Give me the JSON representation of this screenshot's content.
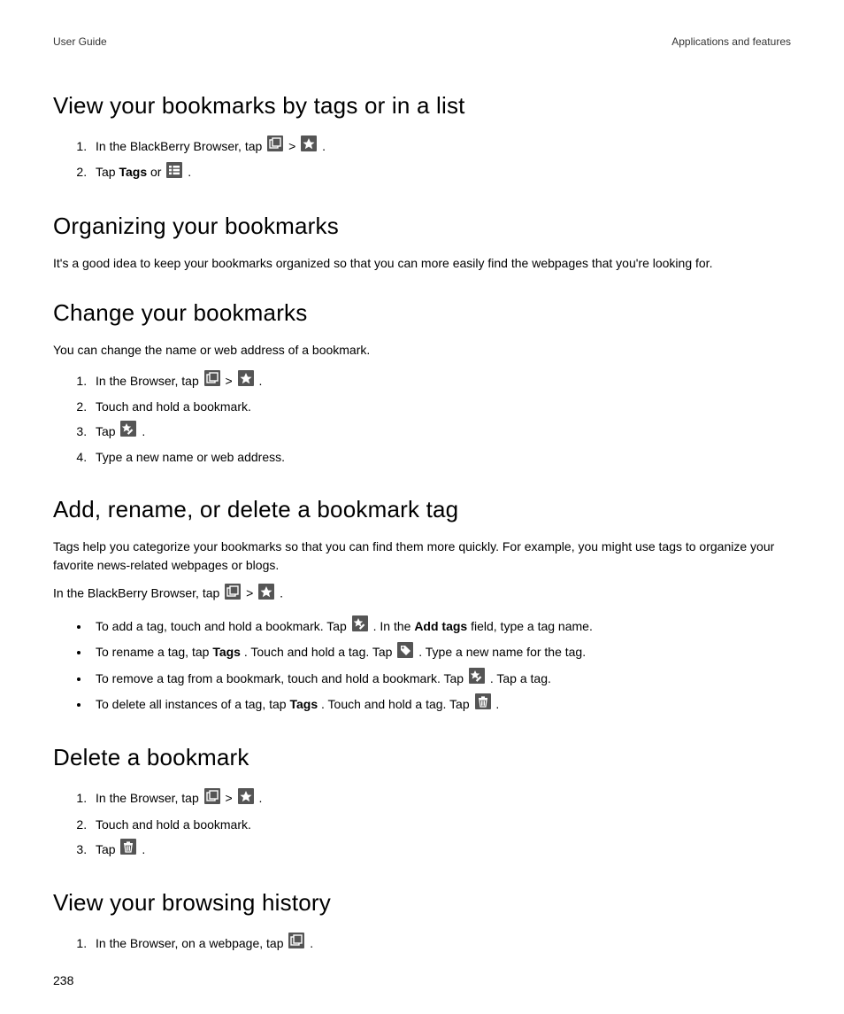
{
  "header": {
    "left": "User Guide",
    "right": "Applications and features"
  },
  "sections": {
    "viewBookmarks": {
      "title": "View your bookmarks by tags or in a list",
      "step1_a": "In the BlackBerry Browser, tap ",
      "step1_gt": " > ",
      "step1_b": ".",
      "step2_a": "Tap ",
      "step2_bold": "Tags",
      "step2_b": " or ",
      "step2_c": "."
    },
    "organizing": {
      "title": "Organizing your bookmarks",
      "body": "It's a good idea to keep your bookmarks organized so that you can more easily find the webpages that you're looking for."
    },
    "change": {
      "title": "Change your bookmarks",
      "body": "You can change the name or web address of a bookmark.",
      "step1_a": "In the Browser, tap ",
      "step1_gt": " > ",
      "step1_b": ".",
      "step2": "Touch and hold a bookmark.",
      "step3_a": "Tap ",
      "step3_b": ".",
      "step4": "Type a new name or web address."
    },
    "addRename": {
      "title": "Add, rename, or delete a bookmark tag",
      "body": "Tags help you categorize your bookmarks so that you can find them more quickly. For example, you might use tags to organize your favorite news-related webpages or blogs.",
      "intro_a": "In the BlackBerry Browser, tap ",
      "intro_gt": " > ",
      "intro_b": ".",
      "b1_a": "To add a tag, touch and hold a bookmark. Tap ",
      "b1_b": ". In the ",
      "b1_bold": "Add tags",
      "b1_c": " field, type a tag name.",
      "b2_a": "To rename a tag, tap ",
      "b2_bold": "Tags",
      "b2_b": ". Touch and hold a tag. Tap ",
      "b2_c": ". Type a new name for the tag.",
      "b3_a": "To remove a tag from a bookmark, touch and hold a bookmark. Tap ",
      "b3_b": ". Tap a tag.",
      "b4_a": "To delete all instances of a tag, tap ",
      "b4_bold": "Tags",
      "b4_b": ". Touch and hold a tag. Tap ",
      "b4_c": "."
    },
    "delete": {
      "title": "Delete a bookmark",
      "step1_a": "In the Browser, tap ",
      "step1_gt": " > ",
      "step1_b": ".",
      "step2": "Touch and hold a bookmark.",
      "step3_a": "Tap ",
      "step3_b": "."
    },
    "history": {
      "title": "View your browsing history",
      "step1_a": "In the Browser, on a webpage, tap ",
      "step1_b": "."
    }
  },
  "pageNumber": "238"
}
